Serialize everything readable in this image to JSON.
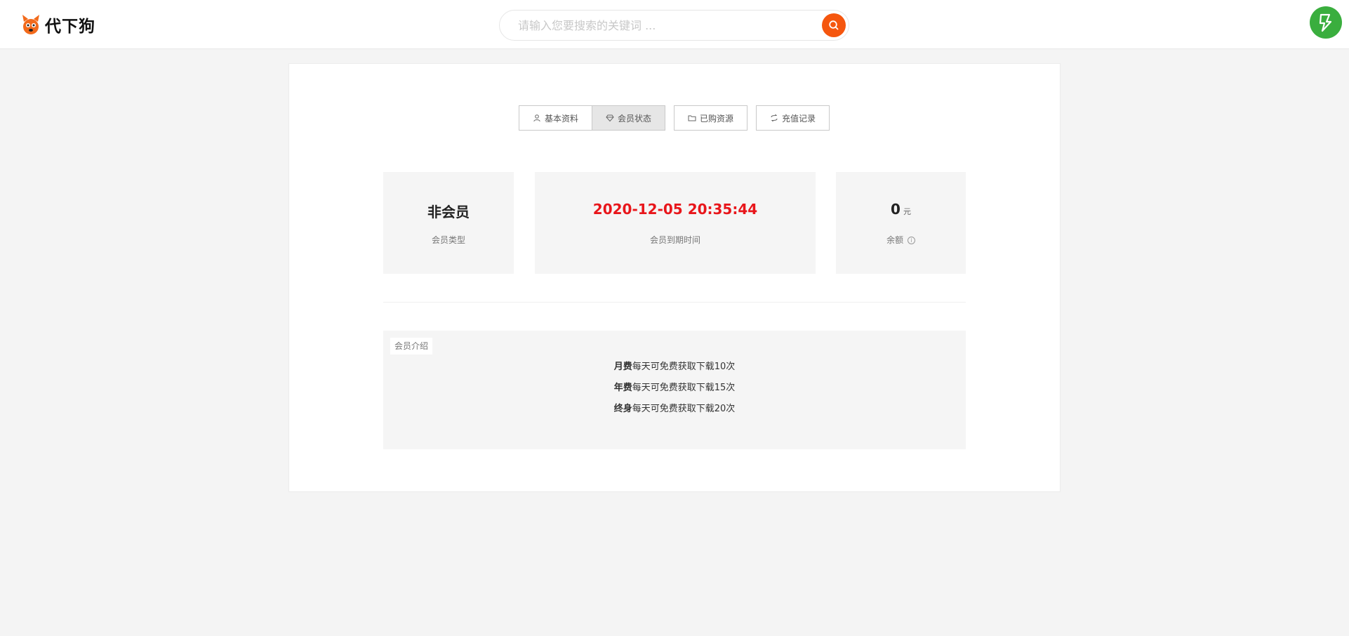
{
  "header": {
    "logo_text": "代下狗",
    "search_placeholder": "请输入您要搜索的关键词 ..."
  },
  "tabs": [
    {
      "label": "基本资料",
      "icon": "user-icon",
      "active": false
    },
    {
      "label": "会员状态",
      "icon": "diamond-icon",
      "active": true
    },
    {
      "label": "已购资源",
      "icon": "folder-icon",
      "active": false
    },
    {
      "label": "充值记录",
      "icon": "refresh-icon",
      "active": false
    }
  ],
  "stats": {
    "member_type": {
      "value": "非会员",
      "label": "会员类型"
    },
    "expiry": {
      "value": "2020-12-05 20:35:44",
      "label": "会员到期时间"
    },
    "balance": {
      "value": "0",
      "unit": "元",
      "label": "余额",
      "info_icon": "i"
    }
  },
  "intro": {
    "tag": "会员介绍",
    "lines": [
      {
        "plan": "月费",
        "text": "每天可免费获取下载10次"
      },
      {
        "plan": "年费",
        "text": "每天可免费获取下载15次"
      },
      {
        "plan": "终身",
        "text": "每天可免费获取下载20次"
      }
    ]
  },
  "colors": {
    "accent": "#f5560e",
    "expiry_red": "#e8161b",
    "avatar_green": "#3aae3e"
  }
}
